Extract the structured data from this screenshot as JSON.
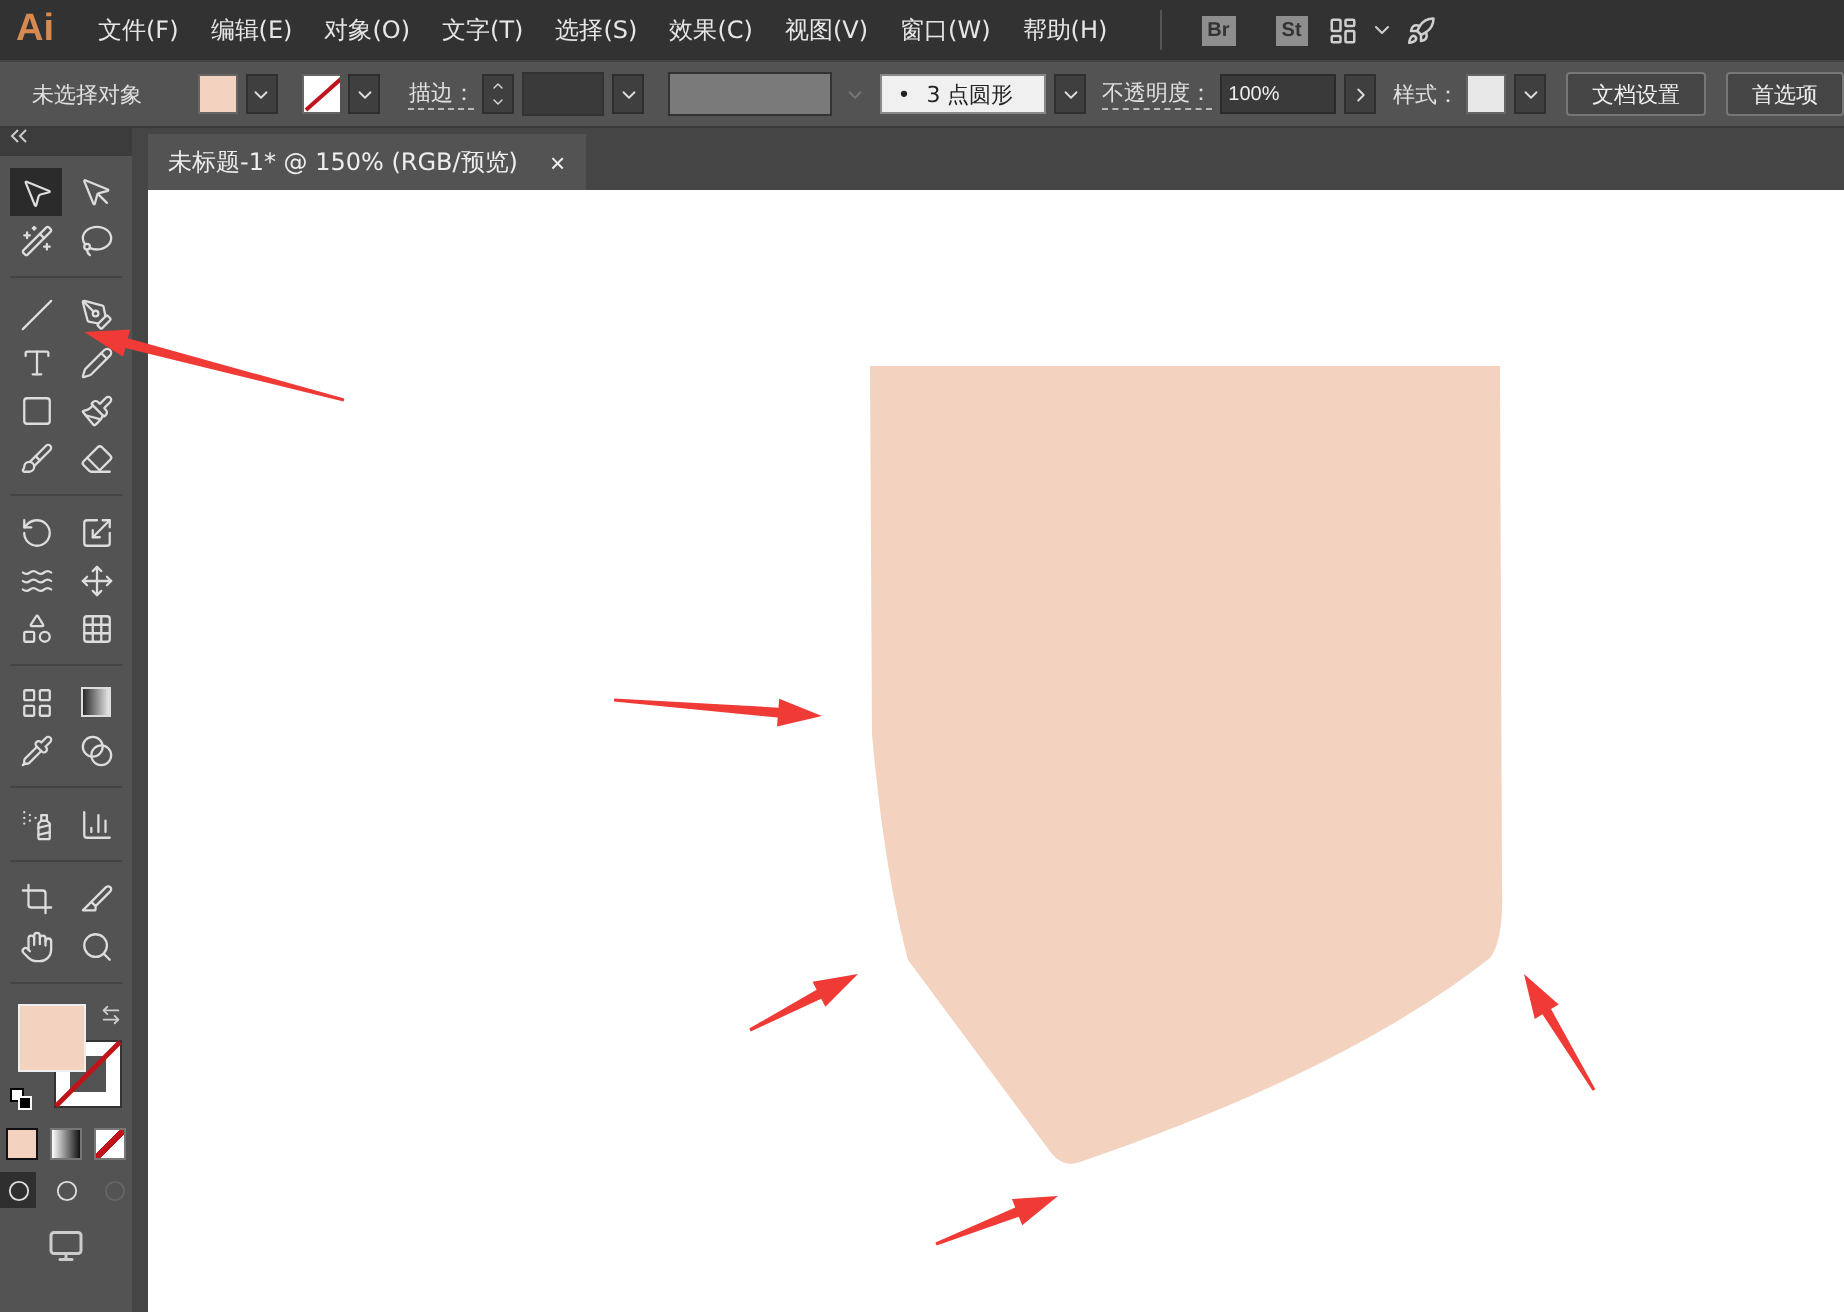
{
  "app_logo": "Ai",
  "menu": [
    "文件(F)",
    "编辑(E)",
    "对象(O)",
    "文字(T)",
    "选择(S)",
    "效果(C)",
    "视图(V)",
    "窗口(W)",
    "帮助(H)"
  ],
  "app_buttons": [
    "Br",
    "St"
  ],
  "control_bar": {
    "selection": "未选择对象",
    "stroke_label": "描边：",
    "brush": "3 点圆形",
    "brush_bullet": "•",
    "opacity_label": "不透明度：",
    "opacity": "100%",
    "style_label": "样式：",
    "buttons": [
      "文档设置",
      "首选项"
    ]
  },
  "document_tab": {
    "title": "未标题-1* @ 150% (RGB/预览)",
    "close": "×"
  },
  "tools": [
    {
      "selected": true
    },
    {
      "selected": false
    },
    {
      "selected": false
    },
    {
      "selected": false
    },
    {
      "selected": false
    },
    {
      "selected": false
    },
    {
      "selected": false
    },
    {
      "selected": false
    },
    {
      "selected": false
    },
    {
      "selected": false
    },
    {
      "selected": false
    },
    {
      "selected": false
    },
    {
      "selected": false
    },
    {
      "selected": false
    },
    {
      "selected": false
    },
    {
      "selected": false
    },
    {
      "selected": false
    },
    {
      "selected": false
    },
    {
      "selected": false
    },
    {
      "selected": false
    },
    {
      "selected": false
    },
    {
      "selected": false
    },
    {
      "selected": false
    },
    {
      "selected": false
    },
    {
      "selected": false
    },
    {
      "selected": false
    },
    {
      "selected": false
    },
    {
      "selected": false
    }
  ],
  "color_modes": [
    {
      "selected": true
    },
    {
      "selected": false
    },
    {
      "selected": false
    }
  ],
  "draw_modes": [
    {
      "selected": true
    },
    {
      "selected": false
    },
    {
      "selected": false,
      "disabled": true
    }
  ]
}
